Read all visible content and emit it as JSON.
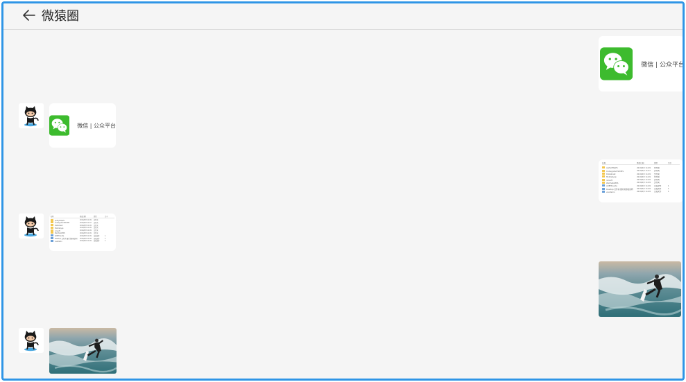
{
  "header": {
    "title": "微猿圈",
    "back_icon": "arrow-left-icon"
  },
  "wechat_card": {
    "label": "微信 | 公众平台"
  },
  "file_listing": {
    "columns": [
      "名称",
      "修改日期",
      "类型",
      "大小"
    ],
    "rows": [
      {
        "name": "ApiHyHttpPS",
        "date": "2019/6/3 11:09",
        "type": "文件夹",
        "size": ""
      },
      {
        "name": "CodeigniterExtCMS",
        "date": "2019/6/3 11:07",
        "type": "文件夹",
        "size": ""
      },
      {
        "name": "Datasheet",
        "date": "2019/6/3 11:09",
        "type": "文件夹",
        "size": ""
      },
      {
        "name": "MobileSysp",
        "date": "2019/6/3 11:09",
        "type": "文件夹",
        "size": ""
      },
      {
        "name": "nmsoft",
        "date": "2019/6/3 11:09",
        "type": "文件夹",
        "size": ""
      },
      {
        "name": "WeChatAPIPS",
        "date": "2019/6/3 11:09",
        "type": "文件夹",
        "size": ""
      },
      {
        "name": "ADBHUsuite",
        "date": "2019/6/3 11:09",
        "type": "压缩文件",
        "size": "1"
      },
      {
        "name": "Desktop 文件夹 图片资源和说明",
        "date": "2019/6/3 11:09",
        "type": "压缩文件",
        "size": "1"
      },
      {
        "name": "vueDemo",
        "date": "2019/6/3 11:09",
        "type": "压缩文件",
        "size": "1"
      }
    ]
  },
  "colors": {
    "frame_border": "#2f95e6",
    "chat_bg": "#f5f5f5",
    "wechat_green": "#3dbb2e"
  }
}
